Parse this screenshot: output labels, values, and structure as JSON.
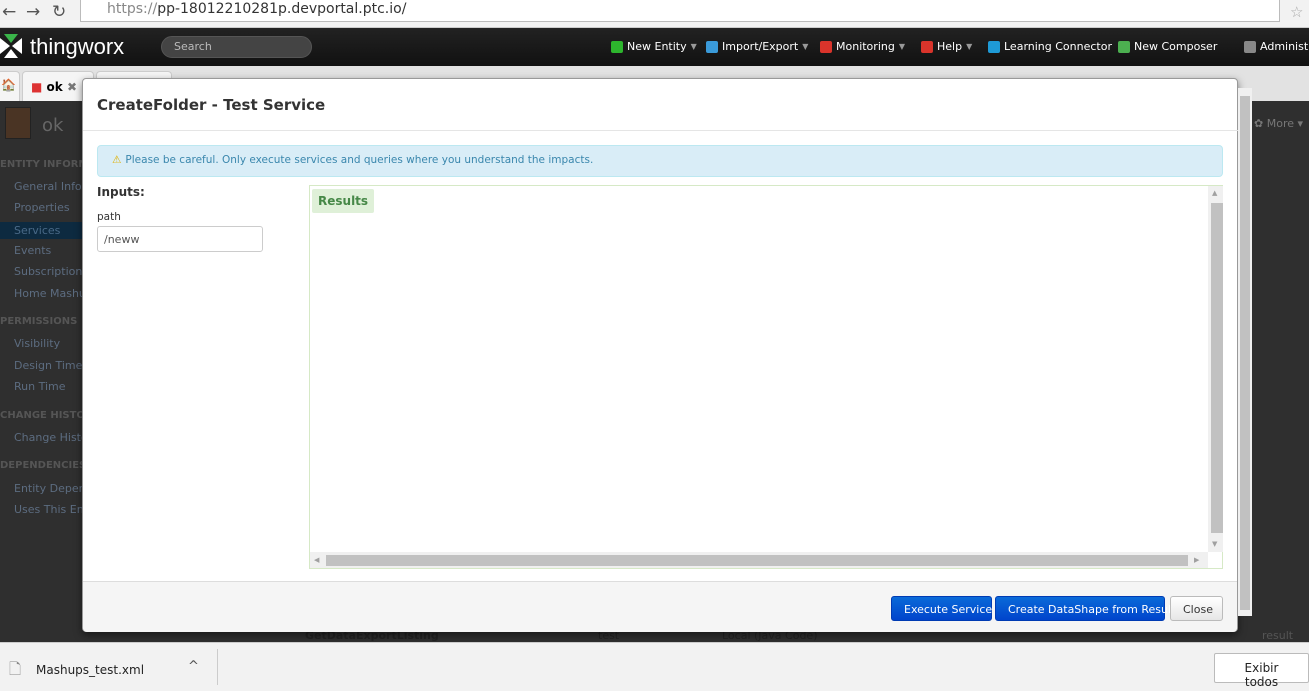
{
  "browser": {
    "url_scheme": "https://",
    "url_host": "pp-18012210281p.devportal.ptc.io/"
  },
  "topnav": {
    "logo": "thingworx",
    "search_placeholder": "Search",
    "menus": [
      {
        "label": "New Entity",
        "icon": "plus-icon",
        "color": "#2db52d",
        "caret": true
      },
      {
        "label": "Import/Export",
        "icon": "import-export-icon",
        "color": "#3a9ad9",
        "caret": true
      },
      {
        "label": "Monitoring",
        "icon": "toolbox-icon",
        "color": "#d9342b",
        "caret": true
      },
      {
        "label": "Help",
        "icon": "lifebuoy-icon",
        "color": "#d9342b",
        "caret": true
      },
      {
        "label": "Learning Connector",
        "icon": "graduation-cap-icon",
        "color": "#1e9ad6",
        "caret": false
      },
      {
        "label": "New Composer",
        "icon": "composer-icon",
        "color": "#4caf50",
        "caret": false
      },
      {
        "label": "Administra",
        "icon": "user-icon",
        "color": "#888",
        "caret": false
      }
    ]
  },
  "tabs": [
    {
      "label": "ok"
    },
    {
      "label": ""
    }
  ],
  "background": {
    "entity_name": "ok",
    "more": "More",
    "sidebar": [
      {
        "type": "head",
        "label": "ENTITY INFORMATION"
      },
      {
        "type": "item",
        "label": "General Information"
      },
      {
        "type": "item",
        "label": "Properties"
      },
      {
        "type": "item",
        "label": "Services",
        "active": true
      },
      {
        "type": "item",
        "label": "Events"
      },
      {
        "type": "item",
        "label": "Subscriptions"
      },
      {
        "type": "item",
        "label": "Home Mashup"
      },
      {
        "type": "head",
        "label": "PERMISSIONS"
      },
      {
        "type": "item",
        "label": "Visibility"
      },
      {
        "type": "item",
        "label": "Design Time"
      },
      {
        "type": "item",
        "label": "Run Time"
      },
      {
        "type": "head",
        "label": "CHANGE HISTORY"
      },
      {
        "type": "item",
        "label": "Change History"
      },
      {
        "type": "head",
        "label": "DEPENDENCIES"
      },
      {
        "type": "item",
        "label": "Entity Dependencies"
      },
      {
        "type": "item",
        "label": "Uses This Entity"
      }
    ],
    "row_service": "GetDataExportListing",
    "row_category": "test",
    "row_type": "Local (Java Code)",
    "row_input": "path",
    "row_output": "result"
  },
  "modal": {
    "title": "CreateFolder - Test Service",
    "alert": "Please be careful. Only execute services and queries where you understand the impacts.",
    "inputs_label": "Inputs:",
    "path_label": "path",
    "path_value": "/neww",
    "results_label": "Results",
    "buttons": {
      "execute": "Execute Service",
      "create_datashape": "Create DataShape from Result",
      "close": "Close"
    }
  },
  "downloads": {
    "file": "Mashups_test.xml",
    "show_all": "Exibir todos"
  }
}
